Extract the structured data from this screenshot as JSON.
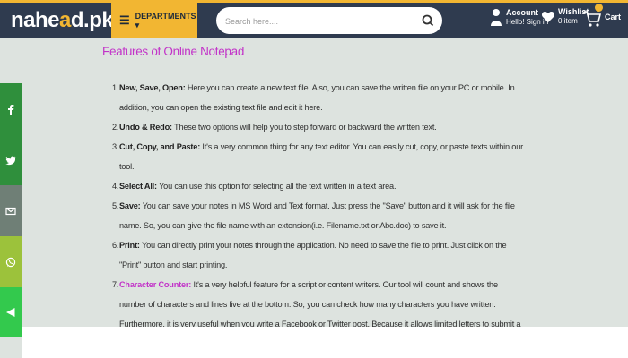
{
  "header": {
    "logo_text": "nahe",
    "logo_text_accent": "a",
    "logo_text_end": "d.pk",
    "departments_label": "DEPARTMENTS ▾",
    "search_placeholder": "Search here....",
    "account_label": "Account",
    "account_sub": "Hello! Sign in",
    "wishlist_label": "Wishlist",
    "wishlist_sub": "0 item",
    "cart_label": "Cart"
  },
  "social": [
    "facebook-icon",
    "twitter-icon",
    "mail-icon",
    "whatsapp-icon",
    "share-icon"
  ],
  "section": {
    "title": "Features of Online Notepad",
    "items": [
      {
        "num": "1.",
        "term": "New, Save, Open:",
        "text": " Here you can create a new text file. Also, you can save the written file on your PC or mobile. In addition, you can open the existing text file and edit it here."
      },
      {
        "num": "2.",
        "term": "Undo & Redo:",
        "text": " These two options will help you to step forward or backward the written text."
      },
      {
        "num": "3.",
        "term": "Cut, Copy, and Paste:",
        "text": " It's a very common thing for any text editor. You can easily cut, copy, or paste texts within our tool."
      },
      {
        "num": "4.",
        "term": "Select All:",
        "text": " You can use this option for selecting all the text written in a text area."
      },
      {
        "num": "5.",
        "term": "Save:",
        "text": " You can save your notes in MS Word and Text format. Just press the \"Save\" button and it will ask for the file name. So, you can give the file name with an extension(i.e. Filename.txt or Abc.doc) to save it."
      },
      {
        "num": "6.",
        "term": "Print:",
        "text": " You can directly print your notes through the application. No need to save the file to print. Just click on the \"Print\" button and start printing."
      },
      {
        "num": "7.",
        "term": "Character Counter:",
        "text": " It's a very helpful feature for a script or content writers. Our tool will count and shows the number of characters and lines live at the bottom. So, you can check how many characters you have written. Furthermore, it is very useful when you write a Facebook or Twitter post. Because it allows limited letters to submit a post."
      }
    ]
  },
  "colors": {
    "header_bg": "#2f3b4f",
    "accent": "#f2b632",
    "title": "#c233c8",
    "page_bg": "#dde3df"
  }
}
